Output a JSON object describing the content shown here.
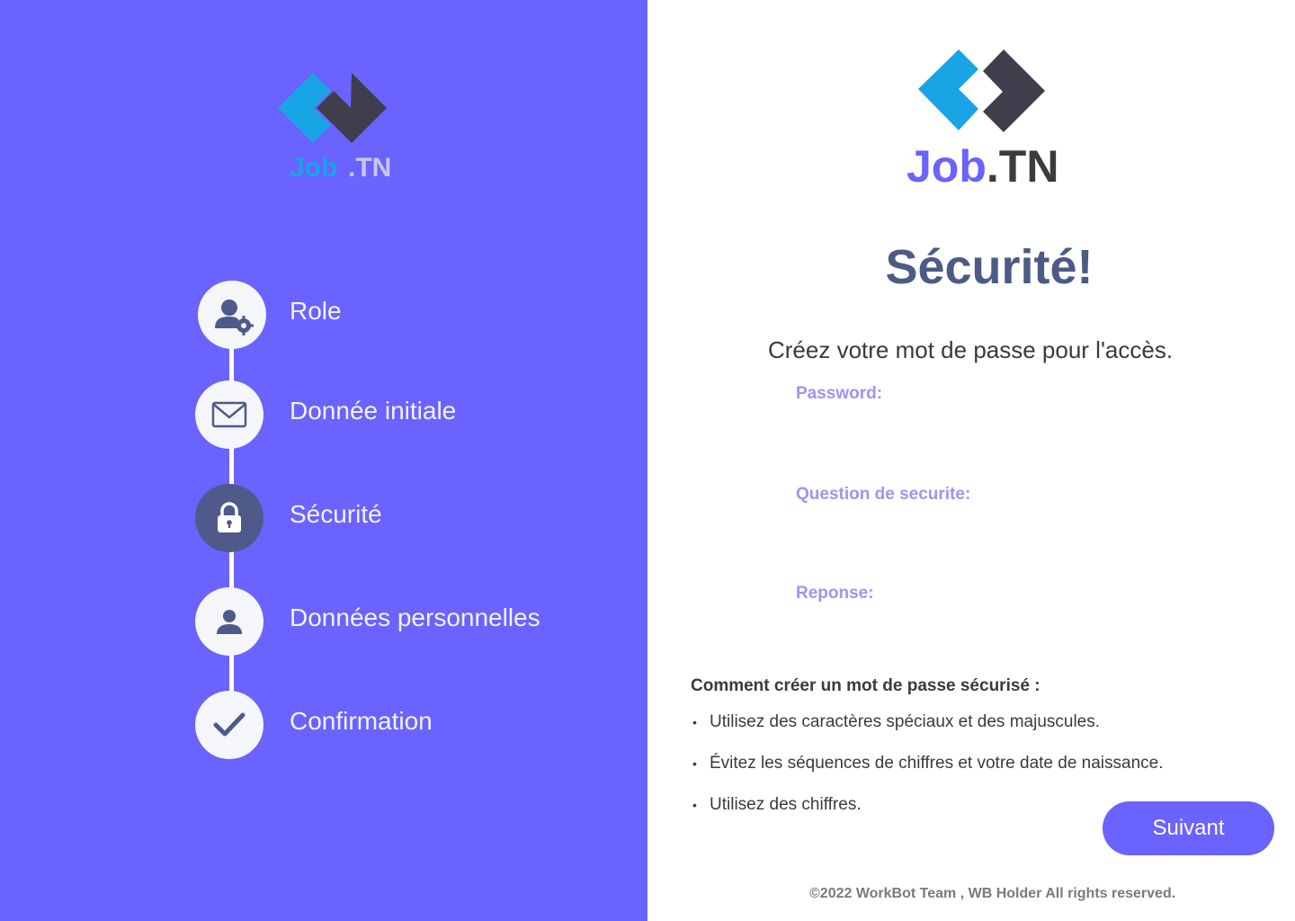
{
  "brand": {
    "name_part1": "Job",
    "name_part2": ".TN"
  },
  "colors": {
    "primary": "#6a63ff",
    "accent_blue": "#19a4e6",
    "dark_logo": "#3f3e4c",
    "title": "#4d5a84",
    "label": "#9c95f2",
    "active_step": "#4f5a8a"
  },
  "steps": [
    {
      "label": "Role",
      "icon": "user-gear-icon",
      "active": false
    },
    {
      "label": "Donnée initiale",
      "icon": "envelope-icon",
      "active": false
    },
    {
      "label": "Sécurité",
      "icon": "lock-icon",
      "active": true
    },
    {
      "label": "Données personnelles",
      "icon": "person-icon",
      "active": false
    },
    {
      "label": "Confirmation",
      "icon": "check-icon",
      "active": false
    }
  ],
  "form": {
    "title": "Sécurité!",
    "subtitle": "Créez votre mot de passe pour l'accès.",
    "fields": [
      {
        "label": "Password:",
        "value": ""
      },
      {
        "label": "Question de securite:",
        "value": ""
      },
      {
        "label": "Reponse:",
        "value": ""
      }
    ],
    "next_label": "Suivant"
  },
  "tips": {
    "title": "Comment créer un mot de passe sécurisé :",
    "bullet": "•",
    "items": [
      "Utilisez des caractères spéciaux et des majuscules.",
      "Évitez les séquences de chiffres et votre date de naissance.",
      "Utilisez des chiffres."
    ]
  },
  "footer": {
    "text": "©2022 WorkBot Team , WB Holder All rights reserved."
  }
}
